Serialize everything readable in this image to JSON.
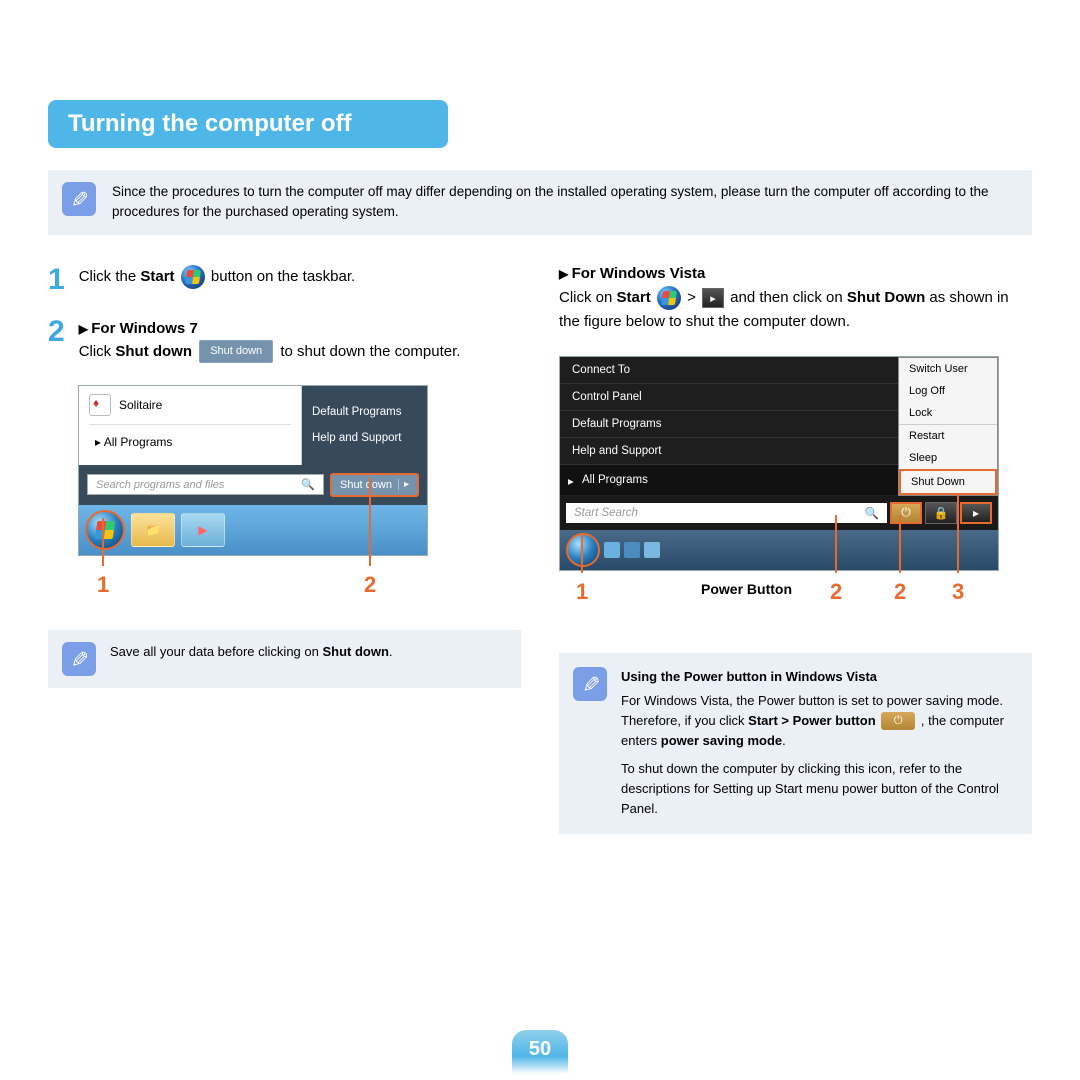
{
  "title": "Turning the computer off",
  "intro_note": "Since the procedures to turn the computer off may differ depending on the installed operating system, please turn the computer off according to the procedures for the purchased operating system.",
  "step1": {
    "num": "1",
    "pre": "Click the ",
    "bold1": "Start",
    "post": " button on the taskbar."
  },
  "step2": {
    "num": "2",
    "heading": "For Windows 7",
    "pre": "Click ",
    "bold": "Shut down",
    "inline_btn": "Shut down",
    "post": " to shut down the computer."
  },
  "scr7": {
    "solitaire": "Solitaire",
    "default_programs": "Default Programs",
    "help": "Help and Support",
    "all_programs": "All Programs",
    "search_placeholder": "Search programs and files",
    "shutdown": "Shut down",
    "callout1": "1",
    "callout2": "2"
  },
  "note_left": {
    "pre": "Save all your data before clicking on ",
    "bold": "Shut down",
    "post": "."
  },
  "vista": {
    "heading": "For Windows Vista",
    "line1_pre": "Click on ",
    "line1_b1": "Start",
    "line1_mid": " > ",
    "line1_post1": " and then click on ",
    "line1_b2": "Shut Down",
    "line1_post2": " as shown in the figure below to shut the computer down."
  },
  "scrv": {
    "connect": "Connect To",
    "cp": "Control Panel",
    "dp": "Default Programs",
    "hs": "Help and Support",
    "allp": "All Programs",
    "search": "Start Search",
    "menu": {
      "switch": "Switch User",
      "logoff": "Log Off",
      "lock": "Lock",
      "restart": "Restart",
      "sleep": "Sleep",
      "shutdown": "Shut Down"
    },
    "c1": "1",
    "c2": "2",
    "c3": "3",
    "power_label": "Power Button"
  },
  "note_right": {
    "title": "Using the Power button in Windows Vista",
    "p1a": "For Windows Vista, the Power button is set to power saving mode. Therefore, if you click ",
    "p1b": "Start > Power button",
    "p1c": ", the computer enters ",
    "p1d": "power saving mode",
    "p1e": ".",
    "p2": "To shut down the computer by clicking this icon, refer to the descriptions for Setting up Start menu power button of the Control Panel."
  },
  "page": "50"
}
